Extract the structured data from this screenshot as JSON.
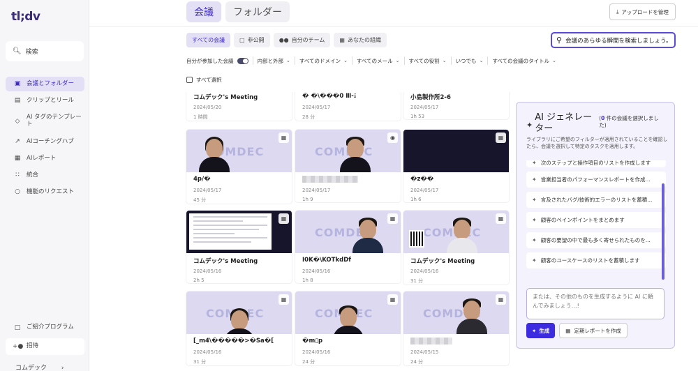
{
  "app": {
    "logo": "tl;dv"
  },
  "sidebar": {
    "search_label": "検索",
    "items": [
      {
        "label": "会議とフォルダー",
        "icon": "video-icon"
      },
      {
        "label": "クリップとリール",
        "icon": "clip-icon"
      },
      {
        "label": "AI タグのテンプレート",
        "icon": "tag-icon"
      },
      {
        "label": "AIコーチングハブ",
        "icon": "chart-icon"
      },
      {
        "label": "AIレポート",
        "icon": "report-icon"
      },
      {
        "label": "統合",
        "icon": "grid-icon"
      },
      {
        "label": "機能のリクエスト",
        "icon": "bulb-icon"
      }
    ],
    "referral_label": "ご紹介プログラム",
    "invite_label": "招待",
    "workspace_label": "コムデック"
  },
  "header": {
    "tabs": [
      {
        "label": "会議"
      },
      {
        "label": "フォルダー"
      }
    ],
    "upload_label": "アップロードを管理"
  },
  "filters": {
    "tabs": [
      {
        "label": "すべての会議"
      },
      {
        "label": "非公開"
      },
      {
        "label": "自分のチーム"
      },
      {
        "label": "あなたの組織"
      }
    ],
    "search_text": "会議のあらゆる瞬間を検索しましょう。",
    "attended_label": "自分が参加した会議",
    "dropdowns": [
      {
        "label": "内部と外部"
      },
      {
        "label": "すべてのドメイン"
      },
      {
        "label": "すべてのメール"
      },
      {
        "label": "すべての役割"
      },
      {
        "label": "いつでも"
      },
      {
        "label": "すべての会議のタイトル"
      }
    ],
    "select_all_label": "すべて選択"
  },
  "meetings": [
    {
      "title": "コムデック's Meeting",
      "date": "2024/05/20",
      "duration": "1 時間"
    },
    {
      "title": "� �\\���0 Ⅲ-፤",
      "date": "2024/05/17",
      "duration": "28 分"
    },
    {
      "title": "小島製作所2-6",
      "date": "2024/05/17",
      "duration": "1h 53"
    },
    {
      "title": "4p/�",
      "date": "2024/05/17",
      "duration": "45 分"
    },
    {
      "title": "",
      "date": "2024/05/17",
      "duration": "1h 9"
    },
    {
      "title": "�z��",
      "date": "2024/05/17",
      "duration": "1h 6"
    },
    {
      "title": "コムデック's Meeting",
      "date": "2024/05/16",
      "duration": "2h 5"
    },
    {
      "title": "I0K�\\KOTkdDf",
      "date": "2024/05/16",
      "duration": "1h 8"
    },
    {
      "title": "コムデック's Meeting",
      "date": "2024/05/16",
      "duration": "31 分"
    },
    {
      "title": "[_m4\\�����>�Sa�[",
      "date": "2024/05/16",
      "duration": "31 分"
    },
    {
      "title": "�m▯p",
      "date": "2024/05/16",
      "duration": "24 分"
    },
    {
      "title": "",
      "date": "2024/05/15",
      "duration": "24 分"
    }
  ],
  "thumb_watermark": "COMDEC",
  "ai_panel": {
    "title": "AI ジェネレーター",
    "count_prefix": "(",
    "count_number": "0",
    "count_suffix": " 件の会議を選択しました)",
    "description": "ライブラリにご希望のフィルターが適用されていることを確認したら、会議を選択して特定のタスクを適用します。",
    "prompts": [
      "次のステップと操作項目のリストを作成します",
      "営業担当者のパフォーマンスレポートを作成...",
      "言及されたバグ/技術的エラーのリストを蓄積...",
      "顧客のペインポイントをまとめます",
      "顧客の要望の中で最も多く寄せられたものを...",
      "顧客のユースケースのリストを蓄積します"
    ],
    "input_placeholder": "または、その他のものを生成するように AI に頼んでみましょう…!",
    "generate_label": "生成",
    "schedule_label": "定期レポートを作成"
  },
  "colors": {
    "accent": "#3d2be0",
    "active_bg": "#e3e0f6",
    "thumb_bg": "#dcd9f1"
  }
}
